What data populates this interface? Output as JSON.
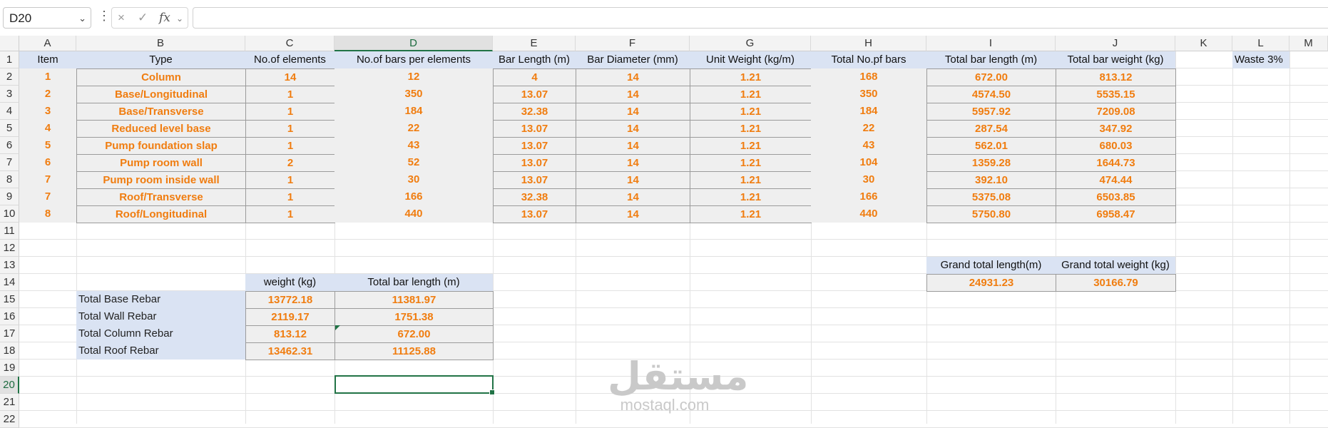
{
  "formula_bar": {
    "name_box": "D20",
    "cancel_icon": "×",
    "enter_icon": "✓",
    "fx_label": "fx",
    "formula": ""
  },
  "columns": [
    "A",
    "B",
    "C",
    "D",
    "E",
    "F",
    "G",
    "H",
    "I",
    "J",
    "K",
    "L",
    "M"
  ],
  "rows": [
    "1",
    "2",
    "3",
    "4",
    "5",
    "6",
    "7",
    "8",
    "9",
    "10",
    "11",
    "12",
    "13",
    "14",
    "15",
    "16",
    "17",
    "18",
    "19",
    "20",
    "21",
    "22"
  ],
  "main_table": {
    "headers": [
      "Item",
      "Type",
      "No.of elements",
      "No.of bars per elements",
      "Bar Length (m)",
      "Bar Diameter (mm)",
      "Unit Weight (kg/m)",
      "Total No.pf bars",
      "Total bar length (m)",
      "Total bar weight (kg)"
    ],
    "rows": [
      [
        "1",
        "Column",
        "14",
        "12",
        "4",
        "14",
        "1.21",
        "168",
        "672.00",
        "813.12"
      ],
      [
        "2",
        "Base/Longitudinal",
        "1",
        "350",
        "13.07",
        "14",
        "1.21",
        "350",
        "4574.50",
        "5535.15"
      ],
      [
        "3",
        "Base/Transverse",
        "1",
        "184",
        "32.38",
        "14",
        "1.21",
        "184",
        "5957.92",
        "7209.08"
      ],
      [
        "4",
        "Reduced level base",
        "1",
        "22",
        "13.07",
        "14",
        "1.21",
        "22",
        "287.54",
        "347.92"
      ],
      [
        "5",
        "Pump foundation slap",
        "1",
        "43",
        "13.07",
        "14",
        "1.21",
        "43",
        "562.01",
        "680.03"
      ],
      [
        "6",
        "Pump room wall",
        "2",
        "52",
        "13.07",
        "14",
        "1.21",
        "104",
        "1359.28",
        "1644.73"
      ],
      [
        "7",
        "Pump room inside wall",
        "1",
        "30",
        "13.07",
        "14",
        "1.21",
        "30",
        "392.10",
        "474.44"
      ],
      [
        "7",
        "Roof/Transverse",
        "1",
        "166",
        "32.38",
        "14",
        "1.21",
        "166",
        "5375.08",
        "6503.85"
      ],
      [
        "8",
        "Roof/Longitudinal",
        "1",
        "440",
        "13.07",
        "14",
        "1.21",
        "440",
        "5750.80",
        "6958.47"
      ]
    ]
  },
  "waste_label": "Waste 3%",
  "summary_table": {
    "headers": [
      "weight (kg)",
      "Total bar length (m)"
    ],
    "rows": [
      [
        "Total Base Rebar",
        "13772.18",
        "11381.97"
      ],
      [
        "Total Wall Rebar",
        "2119.17",
        "1751.38"
      ],
      [
        "Total Column Rebar",
        "813.12",
        "672.00"
      ],
      [
        "Total Roof Rebar",
        "13462.31",
        "11125.88"
      ]
    ]
  },
  "grand_totals": {
    "headers": [
      "Grand total length(m)",
      "Grand total weight (kg)"
    ],
    "values": [
      "24931.23",
      "30166.79"
    ]
  },
  "watermark": {
    "arabic": "مستقل",
    "latin": "mostaql.com"
  }
}
